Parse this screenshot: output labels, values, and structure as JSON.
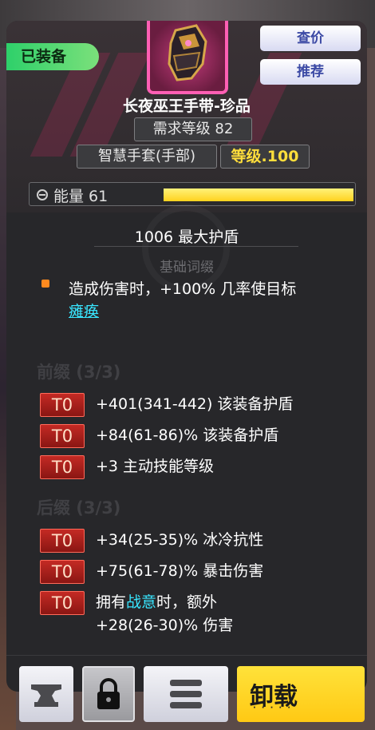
{
  "header": {
    "equipped_label": "已装备",
    "price_check_label": "查价",
    "recommend_label": "推荐"
  },
  "item": {
    "name": "长夜巫王手带-珍品",
    "requirement": "需求等级 82",
    "slot_type": "智慧手套(手部)",
    "level": "等级.100",
    "energy_label": "能量 61",
    "energy_fill": 1.0,
    "main_stat": "1006 最大护盾"
  },
  "base_affix": {
    "title": "基础词缀",
    "text_before": "造成伤害时，+100% 几率使目标",
    "keyword": "瘫痪"
  },
  "prefix": {
    "title": "前缀 (3/3)",
    "affixes": [
      {
        "tier": "T0",
        "text": "+401(341-442) 该装备护盾"
      },
      {
        "tier": "T0",
        "text": "+84(61-86)% 该装备护盾"
      },
      {
        "tier": "T0",
        "text": "+3 主动技能等级"
      }
    ]
  },
  "suffix": {
    "title": "后缀 (3/3)",
    "affixes": [
      {
        "tier": "T0",
        "text": "+34(25-35)% 冰冷抗性"
      },
      {
        "tier": "T0",
        "text": "+75(61-78)% 暴击伤害"
      },
      {
        "tier": "T0",
        "text_before": "拥有",
        "keyword": "战意",
        "text_after": "时，额外",
        "line2": "+28(26-30)% 伤害"
      }
    ]
  },
  "actions": {
    "unequip_label": "卸载",
    "unequip_dots": "·····"
  },
  "colors": {
    "panel_bg": "#27272a",
    "tier_red": "#c42a24",
    "keyword_cyan": "#38e6ff",
    "level_yellow": "#ffde3b",
    "equipped_green": "#2ed06a"
  },
  "icons": [
    "gauntlet-icon",
    "energy-icon",
    "anvil-icon",
    "lock-icon",
    "menu-icon"
  ]
}
